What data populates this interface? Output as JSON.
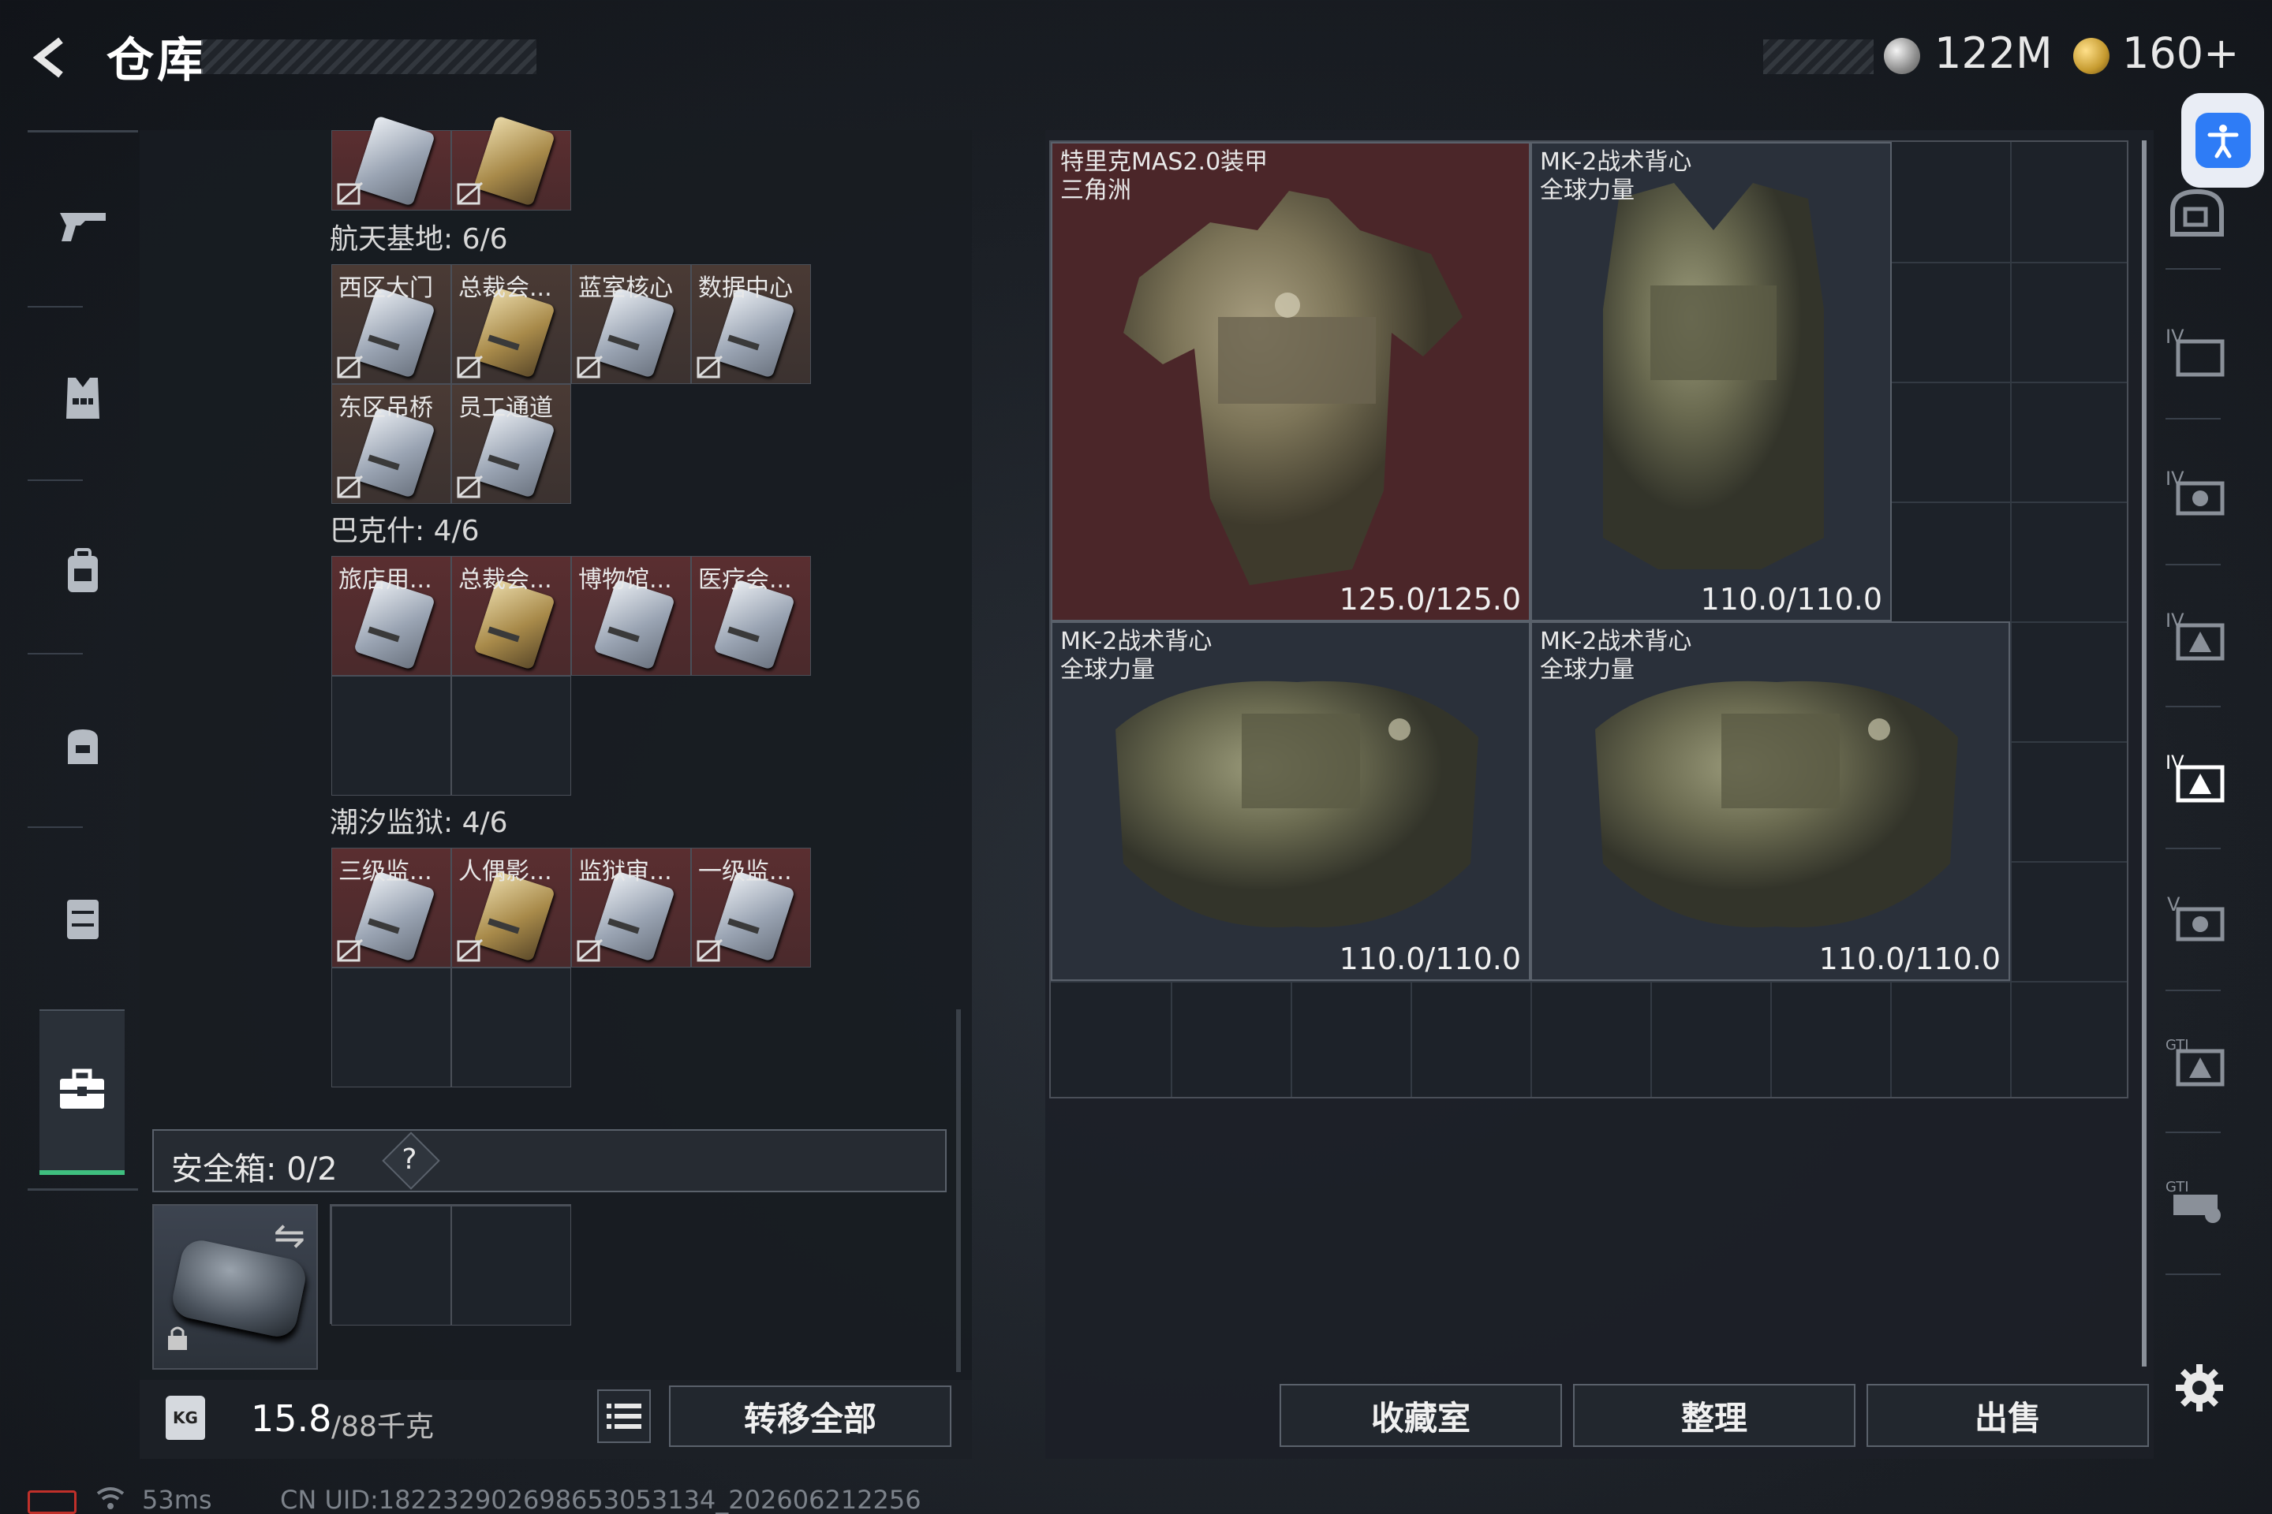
{
  "header": {
    "title": "仓库",
    "currency1": "122M",
    "currency2": "160+"
  },
  "left_sidebar": {
    "items": [
      "weapon",
      "gear",
      "backpack",
      "bag",
      "case",
      "keys"
    ],
    "active": "keys"
  },
  "keys": {
    "sections": [
      {
        "label": "航天基地: 6/6",
        "items": [
          {
            "label": "西区大门",
            "tone": "f"
          },
          {
            "label": "总裁会...",
            "tone": "f"
          },
          {
            "label": "蓝室核心",
            "tone": "f"
          },
          {
            "label": "数据中心",
            "tone": "f"
          },
          {
            "label": "东区吊桥",
            "tone": "f"
          },
          {
            "label": "员工通道",
            "tone": "f"
          }
        ]
      },
      {
        "label": "巴克什: 4/6",
        "items": [
          {
            "label": "旅店用...",
            "tone": "r"
          },
          {
            "label": "总裁会...",
            "tone": "r"
          },
          {
            "label": "博物馆...",
            "tone": "r"
          },
          {
            "label": "医疗会...",
            "tone": "r"
          }
        ]
      },
      {
        "label": "潮汐监狱: 4/6",
        "items": [
          {
            "label": "三级监...",
            "tone": "r"
          },
          {
            "label": "人偶影...",
            "tone": "r"
          },
          {
            "label": "监狱审...",
            "tone": "r"
          },
          {
            "label": "一级监...",
            "tone": "r"
          }
        ]
      }
    ]
  },
  "safe_box": {
    "label": "安全箱: 0/2",
    "help": "?"
  },
  "weight": {
    "current": "15.8",
    "max": "/88千克",
    "kg_label": "KG"
  },
  "actions": {
    "transfer_all": "转移全部",
    "collection": "收藏室",
    "organize": "整理",
    "sell": "出售"
  },
  "armor": [
    {
      "name": "特里克MAS2.0装甲",
      "tag": "三角洲",
      "durability": "125.0/125.0"
    },
    {
      "name": "MK-2战术背心",
      "tag": "全球力量",
      "durability": "110.0/110.0"
    },
    {
      "name": "MK-2战术背心",
      "tag": "全球力量",
      "durability": "110.0/110.0"
    },
    {
      "name": "MK-2战术背心",
      "tag": "全球力量",
      "durability": "110.0/110.0"
    }
  ],
  "right_sidebar": {
    "items": [
      "helmet",
      "IV",
      "IV",
      "IV",
      "IV",
      "V",
      "GTI",
      "GTI"
    ],
    "active_index": 4
  },
  "status": {
    "ping": "53ms",
    "uid": "CN UID:18223290269865305313​4_202606212256"
  }
}
